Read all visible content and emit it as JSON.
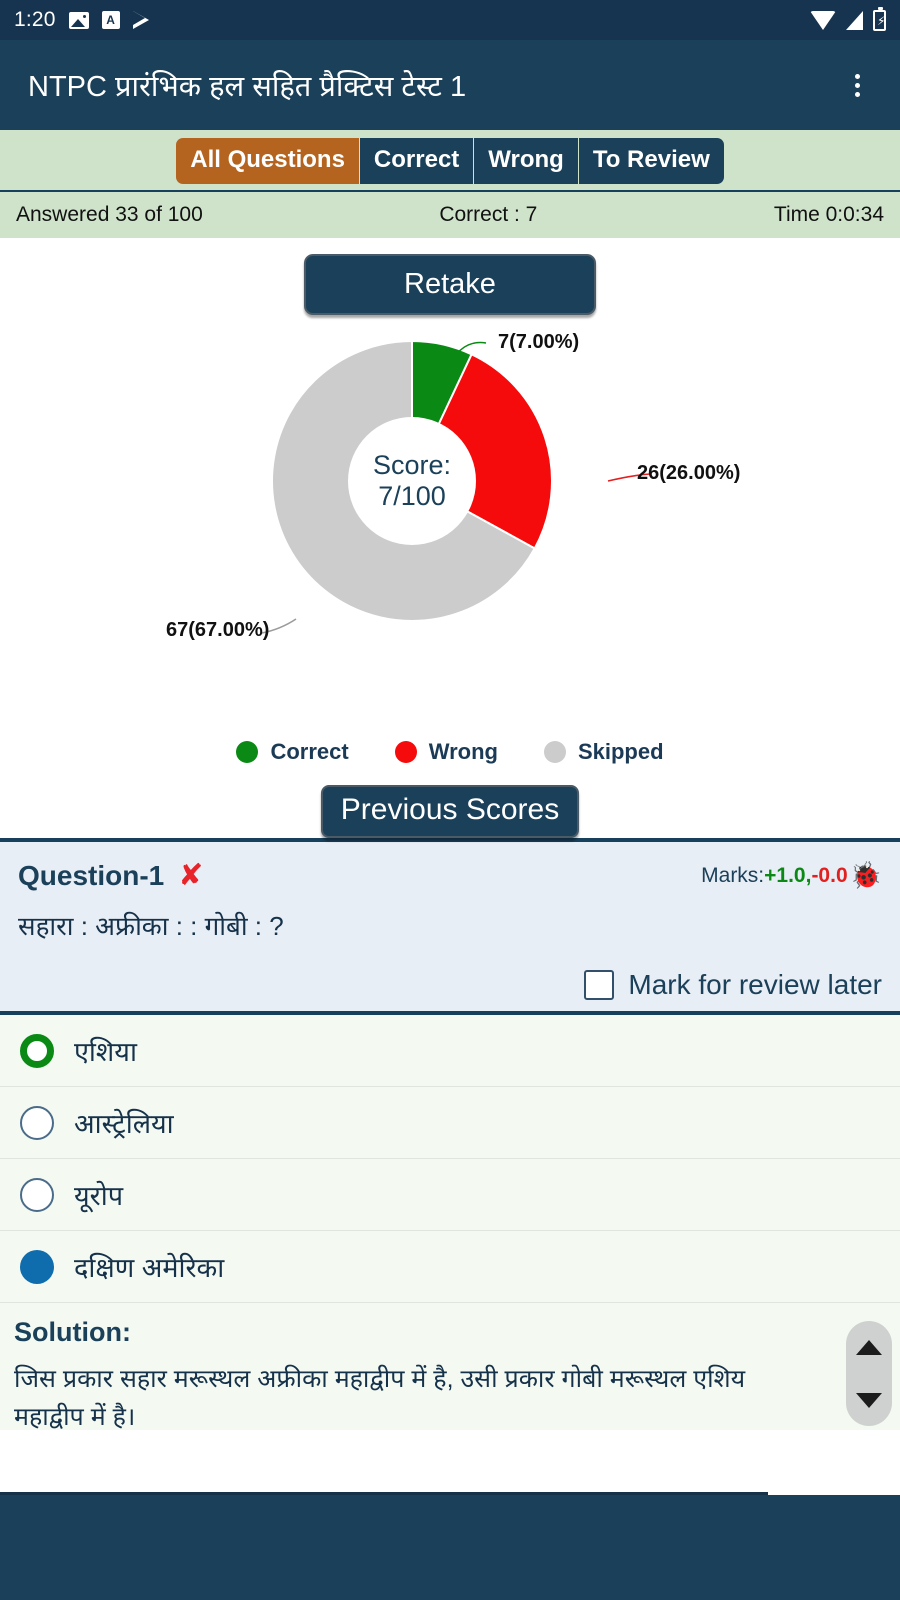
{
  "status_bar": {
    "clock": "1:20",
    "left_icons": [
      "photo-icon",
      "letter-a-icon",
      "play-icon"
    ],
    "right_icons": [
      "wifi-icon",
      "signal-icon",
      "battery-charging-icon"
    ]
  },
  "app_bar": {
    "title": "NTPC प्रारंभिक हल सहित प्रैक्टिस टेस्ट 1",
    "menu_icon": "kebab-menu-icon"
  },
  "tabs": {
    "items": [
      {
        "label": "All Questions",
        "active": true
      },
      {
        "label": "Correct",
        "active": false
      },
      {
        "label": "Wrong",
        "active": false
      },
      {
        "label": "To Review",
        "active": false
      }
    ],
    "active_color": "#b4641f",
    "inactive_color": "#1b4059",
    "strip_bg": "#cfe3ca"
  },
  "summary": {
    "answered": "Answered 33 of 100",
    "correct": "Correct : 7",
    "time": "Time 0:0:34"
  },
  "actions": {
    "retake_label": "Retake",
    "previous_scores_label": "Previous Scores"
  },
  "score": {
    "line1": "Score:",
    "line2": "7/100"
  },
  "chart_data": {
    "type": "pie",
    "title": "",
    "categories": [
      "Correct",
      "Wrong",
      "Skipped"
    ],
    "values": [
      7,
      26,
      67
    ],
    "labels": [
      "7(7.00%)",
      "26(26.00%)",
      "67(67.00%)"
    ],
    "colors": [
      "#0a8a14",
      "#f50b0b",
      "#cccccc"
    ],
    "total": 100,
    "donut": true,
    "inner_radius_ratio": 0.46,
    "start_angle_deg": 0,
    "legend": [
      {
        "label": "Correct",
        "color": "#0a8a14"
      },
      {
        "label": "Wrong",
        "color": "#f50b0b"
      },
      {
        "label": "Skipped",
        "color": "#cccccc"
      }
    ],
    "legend_position": "bottom",
    "center_text": "Score: 7/100"
  },
  "question": {
    "number_label": "Question-1",
    "result_icon": "wrong-cross-icon",
    "marks_prefix": "Marks:",
    "marks_positive": "+1.0,",
    "marks_negative": "-0.0",
    "report_icon": "bug-icon",
    "text": "सहारा : अफ्रीका : : गोबी : ?",
    "review_label": "Mark for review later",
    "review_checked": false
  },
  "options": [
    {
      "label": "एशिया",
      "state": "correct"
    },
    {
      "label": "आस्ट्रेलिया",
      "state": "none"
    },
    {
      "label": "यूरोप",
      "state": "none"
    },
    {
      "label": "दक्षिण अमेरिका",
      "state": "chosen"
    }
  ],
  "solution": {
    "title": "Solution:",
    "line1": "जिस प्रकार सहार मरूस्थल अफ्रीका महाद्वीप में है, उसी प्रकार गोबी मरूस्थल एशिय",
    "line2": "महाद्वीप में है।"
  },
  "scroll_controls": {
    "up_icon": "triangle-up-icon",
    "down_icon": "triangle-down-icon"
  }
}
